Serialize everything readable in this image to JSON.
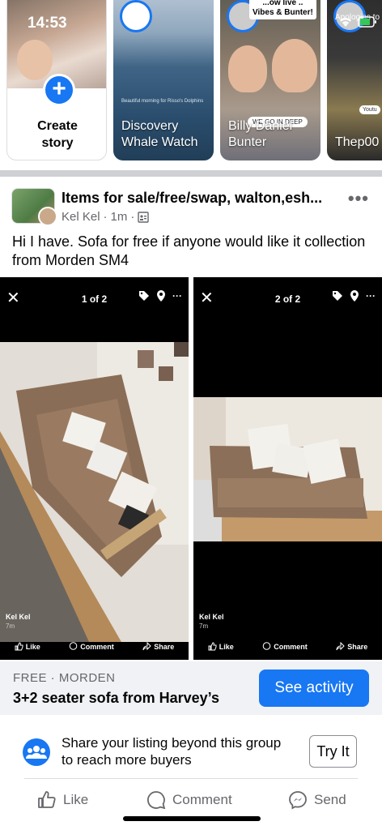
{
  "status_bar": {
    "time": "14:53"
  },
  "stories": {
    "create": {
      "label_line1": "Create",
      "label_line2": "story"
    },
    "items": [
      {
        "name_line1": "Discovery",
        "name_line2": "Whale Watch",
        "caption": "Beautiful morning for Risso's Dolphins"
      },
      {
        "name_line1": "Billy Daniel",
        "name_line2": "Bunter",
        "caption_line1": "...ow live ..",
        "caption_line2": "Vibes & Bunter!",
        "badge": "WE GO IN DEEP"
      },
      {
        "name_line1": "Thep00",
        "caption": "Apologies to th",
        "badge": "Youtu"
      }
    ]
  },
  "post": {
    "group_name": "Items for sale/free/swap, walton,esh...",
    "author": "Kel Kel",
    "time": "1m",
    "text": "Hi I have. Sofa for free if anyone would like it collection from Morden SM4"
  },
  "photos": [
    {
      "counter": "1 of 2",
      "name": "Kel Kel",
      "time": "7m",
      "like": "Like",
      "comment": "Comment",
      "share": "Share"
    },
    {
      "counter": "2 of 2",
      "name": "Kel Kel",
      "time": "7m",
      "like": "Like",
      "comment": "Comment",
      "share": "Share"
    }
  ],
  "listing": {
    "subtitle": "FREE · MORDEN",
    "title": "3+2 seater sofa from Harvey’s",
    "button": "See activity"
  },
  "share_prompt": {
    "text": "Share your listing beyond this group to reach more buyers",
    "button": "Try It"
  },
  "actions": {
    "like": "Like",
    "comment": "Comment",
    "send": "Send"
  },
  "colors": {
    "accent": "#1877f2",
    "muted": "#65676b",
    "listing_bg": "#f0f2f5"
  }
}
